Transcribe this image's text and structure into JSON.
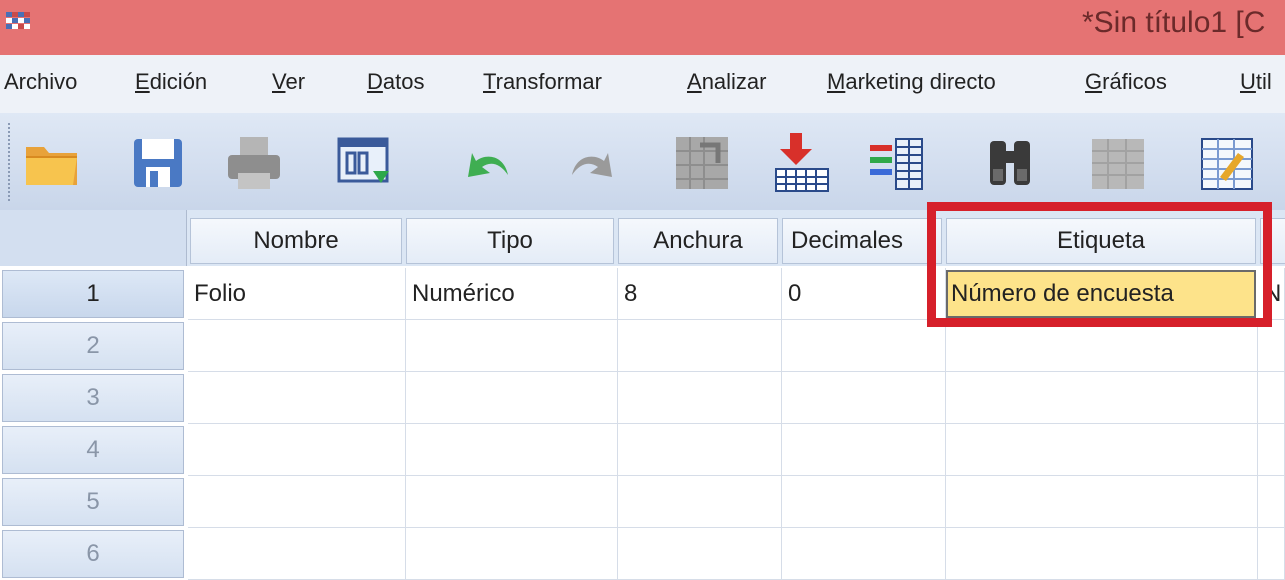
{
  "window": {
    "title": "*Sin título1 [C"
  },
  "menu": [
    {
      "label": "Archivo",
      "accel": ""
    },
    {
      "label": "Edición",
      "accel": "E"
    },
    {
      "label": "Ver",
      "accel": "V"
    },
    {
      "label": "Datos",
      "accel": "D"
    },
    {
      "label": "Transformar",
      "accel": "T"
    },
    {
      "label": "Analizar",
      "accel": "A"
    },
    {
      "label": "Marketing directo",
      "accel": "M"
    },
    {
      "label": "Gráficos",
      "accel": "G"
    },
    {
      "label": "Util",
      "accel": "U"
    }
  ],
  "toolbar": {
    "icons": [
      "open-folder-icon",
      "save-icon",
      "print-icon",
      "dialog-recall-icon",
      "undo-icon",
      "redo-icon",
      "goto-case-icon",
      "goto-variable-icon",
      "variables-icon",
      "find-icon",
      "insert-cases-icon",
      "split-file-icon"
    ]
  },
  "grid": {
    "columns": [
      "Nombre",
      "Tipo",
      "Anchura",
      "Decimales",
      "Etiqueta"
    ],
    "row_numbers": [
      "1",
      "2",
      "3",
      "4",
      "5",
      "6"
    ],
    "rows": [
      [
        "Folio",
        "Numérico",
        "8",
        "0",
        "Número de encuesta",
        "N"
      ],
      [
        "",
        "",
        "",
        "",
        "",
        ""
      ],
      [
        "",
        "",
        "",
        "",
        "",
        ""
      ],
      [
        "",
        "",
        "",
        "",
        "",
        ""
      ],
      [
        "",
        "",
        "",
        "",
        "",
        ""
      ],
      [
        "",
        "",
        "",
        "",
        "",
        ""
      ]
    ],
    "selected_cell": {
      "row": 1,
      "column": "Etiqueta"
    }
  },
  "colors": {
    "titlebar": "#e57373",
    "highlight": "#d6202a",
    "selected_cell": "#fde38a"
  }
}
